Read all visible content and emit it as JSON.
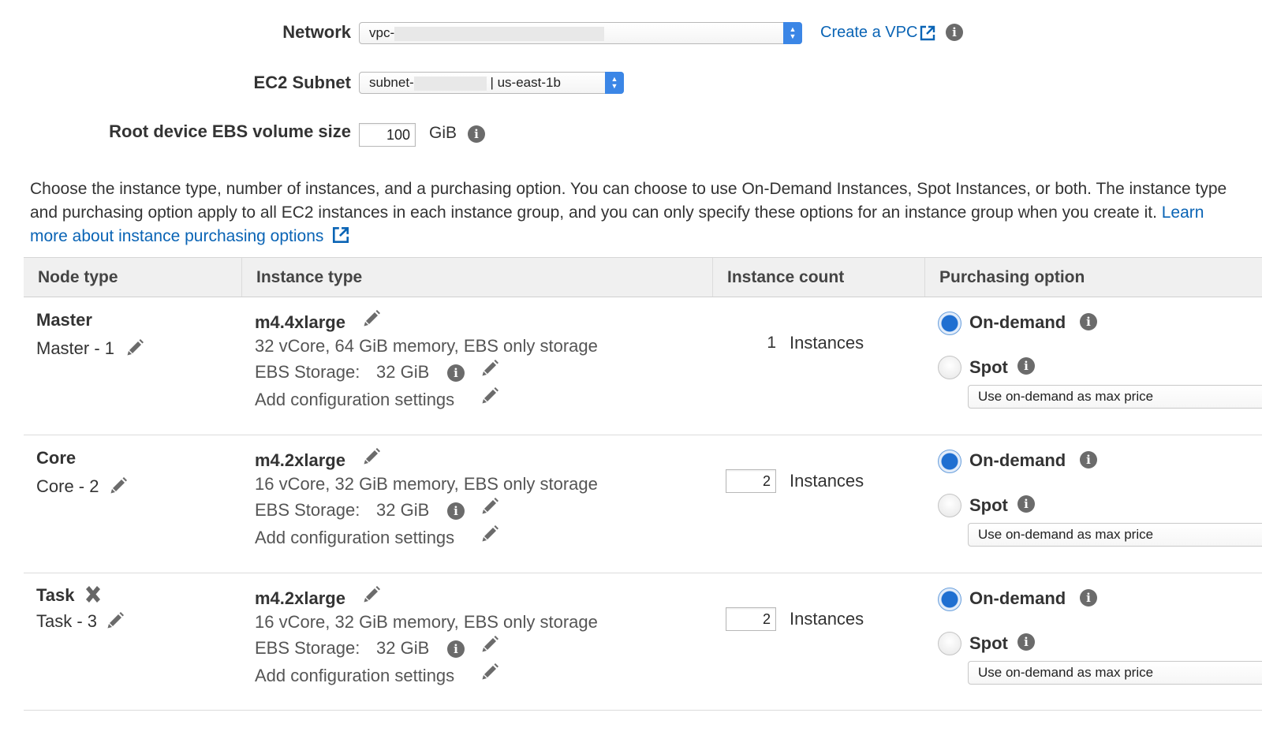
{
  "form": {
    "network": {
      "label": "Network",
      "value_prefix": "vpc-",
      "create_link": "Create a VPC"
    },
    "subnet": {
      "label": "EC2 Subnet",
      "value_prefix": "subnet-",
      "value_suffix": "| us-east-1b"
    },
    "root_volume": {
      "label": "Root device EBS volume size",
      "value": "100",
      "unit": "GiB"
    }
  },
  "description": {
    "text": "Choose the instance type, number of instances, and a purchasing option. You can choose to use On-Demand Instances, Spot Instances, or both. The instance type and purchasing option apply to all EC2 instances in each instance group, and you can only specify these options for an instance group when you create it.",
    "link": "Learn more about instance purchasing options"
  },
  "table": {
    "headers": [
      "Node type",
      "Instance type",
      "Instance count",
      "Purchasing option"
    ],
    "rows": [
      {
        "node_type": "Master",
        "node_name": "Master - 1",
        "instance_type": "m4.4xlarge",
        "spec": "32 vCore, 64 GiB memory, EBS only storage",
        "ebs_label": "EBS Storage:",
        "ebs_value": "32 GiB",
        "add_config": "Add configuration settings",
        "count": "1",
        "count_unit": "Instances",
        "on_demand_label": "On-demand",
        "spot_label": "Spot",
        "price_option": "Use on-demand as max price"
      },
      {
        "node_type": "Core",
        "node_name": "Core - 2",
        "instance_type": "m4.2xlarge",
        "spec": "16 vCore, 32 GiB memory, EBS only storage",
        "ebs_label": "EBS Storage:",
        "ebs_value": "32 GiB",
        "add_config": "Add configuration settings",
        "count": "2",
        "count_unit": "Instances",
        "on_demand_label": "On-demand",
        "spot_label": "Spot",
        "price_option": "Use on-demand as max price"
      },
      {
        "node_type": "Task",
        "node_name": "Task - 3",
        "instance_type": "m4.2xlarge",
        "spec": "16 vCore, 32 GiB memory, EBS only storage",
        "ebs_label": "EBS Storage:",
        "ebs_value": "32 GiB",
        "add_config": "Add configuration settings",
        "count": "2",
        "count_unit": "Instances",
        "on_demand_label": "On-demand",
        "spot_label": "Spot",
        "price_option": "Use on-demand as max price"
      }
    ]
  },
  "colors": {
    "link": "#0a64b5",
    "radio_selected": "#1f6fd1",
    "select_arrow": "#3b86e6",
    "header_bg": "#f0f0f0"
  },
  "icons": [
    "info-icon",
    "external-link-icon",
    "pencil-icon",
    "remove-icon",
    "select-arrow-icon"
  ]
}
